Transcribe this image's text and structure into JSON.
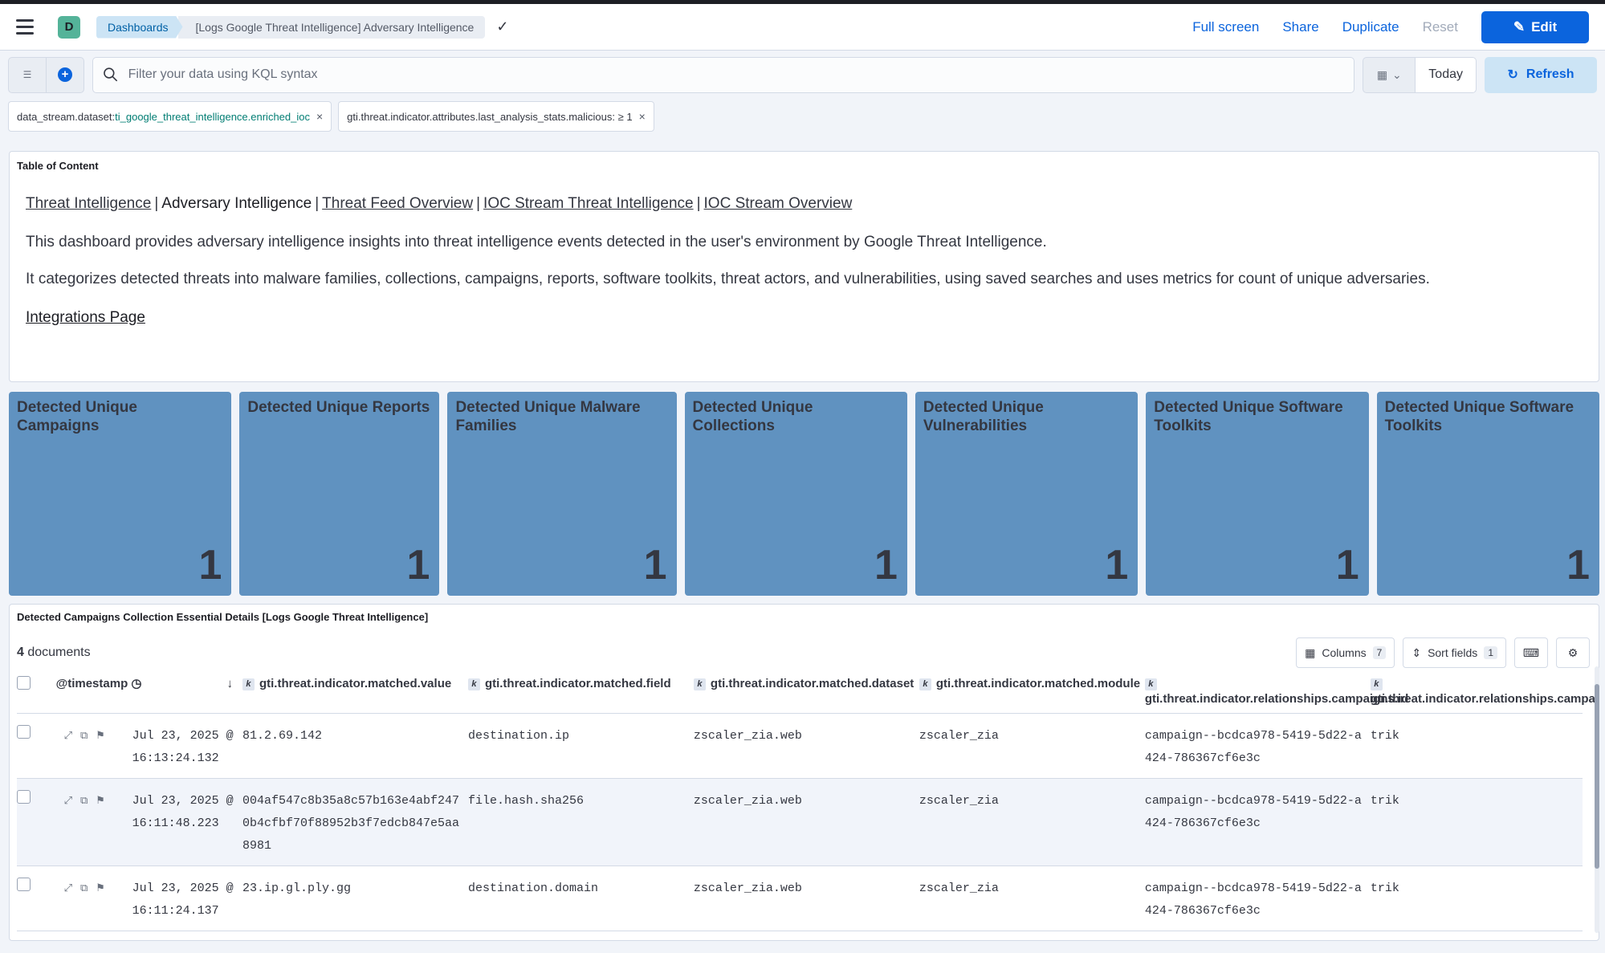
{
  "header": {
    "space_initial": "D",
    "breadcrumbs": [
      "Dashboards",
      "[Logs Google Threat Intelligence] Adversary Intelligence"
    ],
    "actions": {
      "full_screen": "Full screen",
      "share": "Share",
      "duplicate": "Duplicate",
      "reset": "Reset",
      "edit": "Edit"
    }
  },
  "query": {
    "placeholder": "Filter your data using KQL syntax",
    "date": "Today",
    "refresh": "Refresh"
  },
  "filters": [
    {
      "key": "data_stream.dataset: ",
      "value": "ti_google_threat_intelligence.enriched_ioc"
    },
    {
      "key": "gti.threat.indicator.attributes.last_analysis_stats.malicious: ≥ 1",
      "value": ""
    }
  ],
  "toc": {
    "title": "Table of Content",
    "links": {
      "threat_intel": "Threat Intelligence",
      "current": "Adversary Intelligence",
      "feed": "Threat Feed Overview",
      "ioc_stream_ti": "IOC Stream Threat Intelligence",
      "ioc_stream_overview": "IOC Stream Overview"
    },
    "p1": "This dashboard provides adversary intelligence insights into threat intelligence events detected in the user's environment by Google Threat Intelligence.",
    "p2": "It categorizes detected threats into malware families, collections, campaigns, reports, software toolkits, threat actors, and vulnerabilities, using saved searches and uses metrics for count of unique adversaries.",
    "integrations": "Integrations Page"
  },
  "metrics": [
    {
      "title": "Detected Unique Campaigns",
      "value": "1"
    },
    {
      "title": "Detected Unique Reports",
      "value": "1"
    },
    {
      "title": "Detected Unique Malware Families",
      "value": "1"
    },
    {
      "title": "Detected Unique Collections",
      "value": "1"
    },
    {
      "title": "Detected Unique Vulnerabilities",
      "value": "1"
    },
    {
      "title": "Detected Unique Software Toolkits",
      "value": "1"
    },
    {
      "title": "Detected Unique Software Toolkits",
      "value": "1"
    }
  ],
  "table": {
    "title": "Detected Campaigns Collection Essential Details [Logs Google Threat Intelligence]",
    "doc_count": "4",
    "doc_label": " documents",
    "columns_label": "Columns",
    "columns_count": "7",
    "sort_label": "Sort fields",
    "sort_count": "1",
    "headers": {
      "timestamp": "@timestamp",
      "value": "gti.threat.indicator.matched.value",
      "field": "gti.threat.indicator.matched.field",
      "dataset": "gti.threat.indicator.matched.dataset",
      "module": "gti.threat.indicator.matched.module",
      "campaign_id": "gti.threat.indicator.relationships.campaigns.id",
      "campaign_name": "gti.threat.indicator.relationships.campaigns.attributes.name"
    },
    "rows": [
      {
        "timestamp": "Jul 23, 2025 @ 16:13:24.132",
        "value": "81.2.69.142",
        "field": "destination.ip",
        "dataset": "zscaler_zia.web",
        "module": "zscaler_zia",
        "campaign_id": "campaign--bcdca978-5419-5d22-a424-786367cf6e3c",
        "campaign_name": "trik"
      },
      {
        "timestamp": "Jul 23, 2025 @ 16:11:48.223",
        "value": "004af547c8b35a8c57b163e4abf2470b4cfbf70f88952b3f7edcb847e5aa8981",
        "field": "file.hash.sha256",
        "dataset": "zscaler_zia.web",
        "module": "zscaler_zia",
        "campaign_id": "campaign--bcdca978-5419-5d22-a424-786367cf6e3c",
        "campaign_name": "trik"
      },
      {
        "timestamp": "Jul 23, 2025 @ 16:11:24.137",
        "value": "23.ip.gl.ply.gg",
        "field": "destination.domain",
        "dataset": "zscaler_zia.web",
        "module": "zscaler_zia",
        "campaign_id": "campaign--bcdca978-5419-5d22-a424-786367cf6e3c",
        "campaign_name": "trik"
      }
    ]
  }
}
